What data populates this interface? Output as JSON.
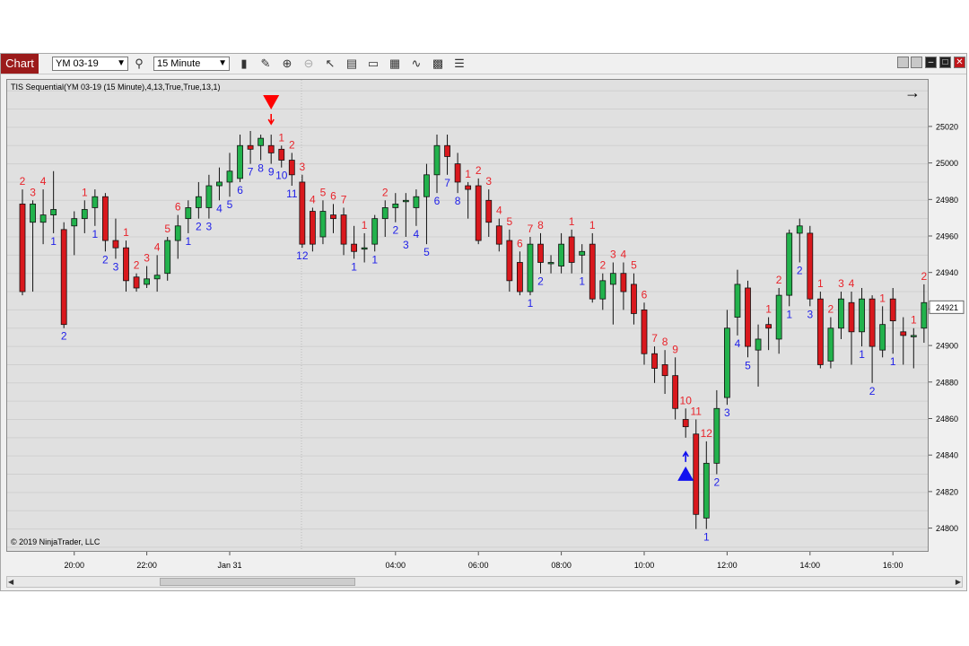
{
  "toolbar": {
    "tab_label": "Chart",
    "instrument": "YM 03-19",
    "interval": "15 Minute"
  },
  "chart": {
    "indicator_label": "TIS Sequential(YM 03-19 (15 Minute),4,13,True,True,13,1)",
    "copyright": "© 2019 NinjaTrader, LLC",
    "current_price": "24921",
    "colors": {
      "up": "#22b24c",
      "down": "#d9181d",
      "sell_count": "#e8232a",
      "buy_count": "#2020e8"
    }
  },
  "chart_data": {
    "type": "candlestick",
    "y_ticks": [
      24800,
      24820,
      24840,
      24860,
      24880,
      24900,
      24920,
      24940,
      24960,
      24980,
      25000,
      25020
    ],
    "ylim": [
      24788,
      25046
    ],
    "x_labels": [
      "20:00",
      "22:00",
      "Jan 31",
      "04:00",
      "06:00",
      "08:00",
      "10:00",
      "12:00",
      "14:00",
      "16:00"
    ],
    "grid": true,
    "bars": [
      [
        24978,
        24930,
        24986,
        24928
      ],
      [
        24968,
        24978,
        24980,
        24930
      ],
      [
        24968,
        24972,
        24986,
        24956
      ],
      [
        24972,
        24975,
        24996,
        24962
      ],
      [
        24964,
        24912,
        24968,
        24910
      ],
      [
        24966,
        24970,
        24974,
        24950
      ],
      [
        24970,
        24975,
        24980,
        24962
      ],
      [
        24976,
        24982,
        24986,
        24966
      ],
      [
        24982,
        24958,
        24984,
        24952
      ],
      [
        24958,
        24954,
        24970,
        24948
      ],
      [
        24954,
        24936,
        24958,
        24930
      ],
      [
        24938,
        24932,
        24940,
        24930
      ],
      [
        24934,
        24937,
        24944,
        24932
      ],
      [
        24937,
        24939,
        24950,
        24930
      ],
      [
        24940,
        24958,
        24960,
        24936
      ],
      [
        24958,
        24966,
        24972,
        24948
      ],
      [
        24970,
        24976,
        24980,
        24962
      ],
      [
        24976,
        24982,
        24990,
        24970
      ],
      [
        24976,
        24988,
        24994,
        24970
      ],
      [
        24988,
        24990,
        24998,
        24980
      ],
      [
        24990,
        24996,
        25006,
        24982
      ],
      [
        24992,
        25010,
        25016,
        24990
      ],
      [
        25010,
        25008,
        25018,
        25000
      ],
      [
        25010,
        25014,
        25016,
        25002
      ],
      [
        25010,
        25006,
        25016,
        25000
      ],
      [
        25008,
        25002,
        25010,
        24998
      ],
      [
        25002,
        24994,
        25006,
        24988
      ],
      [
        24990,
        24956,
        24994,
        24954
      ],
      [
        24974,
        24956,
        24976,
        24952
      ],
      [
        24960,
        24974,
        24980,
        24956
      ],
      [
        24972,
        24970,
        24978,
        24962
      ],
      [
        24972,
        24956,
        24976,
        24950
      ],
      [
        24956,
        24952,
        24966,
        24948
      ],
      [
        24954,
        24954,
        24962,
        24946
      ],
      [
        24956,
        24970,
        24972,
        24952
      ],
      [
        24970,
        24976,
        24980,
        24960
      ],
      [
        24976,
        24978,
        24984,
        24968
      ],
      [
        24980,
        24980,
        24984,
        24960
      ],
      [
        24976,
        24982,
        24986,
        24966
      ],
      [
        24982,
        24994,
        25000,
        24956
      ],
      [
        24994,
        25010,
        25016,
        24984
      ],
      [
        25010,
        25004,
        25016,
        24994
      ],
      [
        25000,
        24990,
        25006,
        24984
      ],
      [
        24988,
        24986,
        24990,
        24970
      ],
      [
        24988,
        24958,
        24992,
        24956
      ],
      [
        24980,
        24968,
        24986,
        24960
      ],
      [
        24966,
        24956,
        24970,
        24952
      ],
      [
        24958,
        24936,
        24964,
        24930
      ],
      [
        24946,
        24930,
        24952,
        24928
      ],
      [
        24930,
        24956,
        24960,
        24928
      ],
      [
        24956,
        24946,
        24962,
        24940
      ],
      [
        24946,
        24946,
        24950,
        24940
      ],
      [
        24944,
        24956,
        24962,
        24940
      ],
      [
        24960,
        24946,
        24964,
        24940
      ],
      [
        24950,
        24952,
        24956,
        24940
      ],
      [
        24956,
        24926,
        24962,
        24924
      ],
      [
        24926,
        24936,
        24940,
        24920
      ],
      [
        24934,
        24940,
        24946,
        24912
      ],
      [
        24940,
        24930,
        24946,
        24920
      ],
      [
        24934,
        24918,
        24940,
        24912
      ],
      [
        24920,
        24896,
        24924,
        24890
      ],
      [
        24896,
        24888,
        24900,
        24880
      ],
      [
        24890,
        24884,
        24898,
        24874
      ],
      [
        24884,
        24866,
        24894,
        24860
      ],
      [
        24860,
        24856,
        24866,
        24850
      ],
      [
        24852,
        24808,
        24860,
        24800
      ],
      [
        24806,
        24836,
        24848,
        24800
      ],
      [
        24836,
        24866,
        24876,
        24830
      ],
      [
        24872,
        24910,
        24920,
        24868
      ],
      [
        24916,
        24934,
        24942,
        24906
      ],
      [
        24932,
        24900,
        24936,
        24894
      ],
      [
        24898,
        24904,
        24912,
        24878
      ],
      [
        24912,
        24910,
        24916,
        24898
      ],
      [
        24904,
        24928,
        24932,
        24896
      ],
      [
        24928,
        24962,
        24964,
        24922
      ],
      [
        24962,
        24966,
        24970,
        24946
      ],
      [
        24962,
        24926,
        24966,
        24922
      ],
      [
        24926,
        24890,
        24930,
        24888
      ],
      [
        24892,
        24910,
        24916,
        24888
      ],
      [
        24910,
        24926,
        24930,
        24904
      ],
      [
        24924,
        24908,
        24930,
        24890
      ],
      [
        24908,
        24926,
        24932,
        24900
      ],
      [
        24926,
        24900,
        24928,
        24880
      ],
      [
        24898,
        24912,
        24922,
        24894
      ],
      [
        24926,
        24914,
        24932,
        24896
      ],
      [
        24908,
        24906,
        24916,
        24890
      ],
      [
        24906,
        24906,
        24910,
        24888
      ],
      [
        24910,
        24924,
        24934,
        24902
      ]
    ],
    "counts": [
      {
        "i": 0,
        "t": "2",
        "pos": "above"
      },
      {
        "i": 1,
        "t": "3",
        "pos": "above"
      },
      {
        "i": 2,
        "t": "4",
        "pos": "above"
      },
      {
        "i": 3,
        "t": "1",
        "pos": "below"
      },
      {
        "i": 4,
        "t": "2",
        "pos": "below"
      },
      {
        "i": 6,
        "t": "1",
        "pos": "above"
      },
      {
        "i": 7,
        "t": "1",
        "pos": "below"
      },
      {
        "i": 8,
        "t": "2",
        "pos": "below"
      },
      {
        "i": 9,
        "t": "3",
        "pos": "below"
      },
      {
        "i": 10,
        "t": "1",
        "pos": "above"
      },
      {
        "i": 11,
        "t": "2",
        "pos": "above"
      },
      {
        "i": 12,
        "t": "3",
        "pos": "above"
      },
      {
        "i": 13,
        "t": "4",
        "pos": "above"
      },
      {
        "i": 14,
        "t": "5",
        "pos": "above"
      },
      {
        "i": 15,
        "t": "6",
        "pos": "above"
      },
      {
        "i": 16,
        "t": "1",
        "pos": "below"
      },
      {
        "i": 17,
        "t": "2",
        "pos": "below"
      },
      {
        "i": 18,
        "t": "3",
        "pos": "below"
      },
      {
        "i": 19,
        "t": "4",
        "pos": "below"
      },
      {
        "i": 20,
        "t": "5",
        "pos": "below"
      },
      {
        "i": 21,
        "t": "6",
        "pos": "below"
      },
      {
        "i": 22,
        "t": "7",
        "pos": "below"
      },
      {
        "i": 23,
        "t": "8",
        "pos": "below"
      },
      {
        "i": 24,
        "t": "9",
        "pos": "below"
      },
      {
        "i": 25,
        "t": "10",
        "pos": "below"
      },
      {
        "i": 26,
        "t": "11",
        "pos": "below"
      },
      {
        "i": 27,
        "t": "12",
        "pos": "below"
      },
      {
        "i": 25,
        "t": "1",
        "pos": "above"
      },
      {
        "i": 26,
        "t": "2",
        "pos": "above"
      },
      {
        "i": 27,
        "t": "3",
        "pos": "above"
      },
      {
        "i": 28,
        "t": "4",
        "pos": "above"
      },
      {
        "i": 29,
        "t": "5",
        "pos": "above"
      },
      {
        "i": 30,
        "t": "6",
        "pos": "above"
      },
      {
        "i": 31,
        "t": "7",
        "pos": "above"
      },
      {
        "i": 32,
        "t": "1",
        "pos": "below"
      },
      {
        "i": 33,
        "t": "1",
        "pos": "above"
      },
      {
        "i": 34,
        "t": "1",
        "pos": "below"
      },
      {
        "i": 35,
        "t": "2",
        "pos": "above"
      },
      {
        "i": 36,
        "t": "2",
        "pos": "below"
      },
      {
        "i": 37,
        "t": "3",
        "pos": "below"
      },
      {
        "i": 38,
        "t": "4",
        "pos": "below"
      },
      {
        "i": 39,
        "t": "5",
        "pos": "below"
      },
      {
        "i": 40,
        "t": "6",
        "pos": "below"
      },
      {
        "i": 41,
        "t": "7",
        "pos": "below"
      },
      {
        "i": 42,
        "t": "8",
        "pos": "below"
      },
      {
        "i": 43,
        "t": "1",
        "pos": "above"
      },
      {
        "i": 44,
        "t": "2",
        "pos": "above"
      },
      {
        "i": 45,
        "t": "3",
        "pos": "above"
      },
      {
        "i": 46,
        "t": "4",
        "pos": "above"
      },
      {
        "i": 47,
        "t": "5",
        "pos": "above"
      },
      {
        "i": 48,
        "t": "6",
        "pos": "above"
      },
      {
        "i": 49,
        "t": "7",
        "pos": "above"
      },
      {
        "i": 50,
        "t": "8",
        "pos": "above"
      },
      {
        "i": 49,
        "t": "1",
        "pos": "below"
      },
      {
        "i": 50,
        "t": "2",
        "pos": "below"
      },
      {
        "i": 53,
        "t": "1",
        "pos": "above"
      },
      {
        "i": 54,
        "t": "1",
        "pos": "below"
      },
      {
        "i": 55,
        "t": "1",
        "pos": "above"
      },
      {
        "i": 56,
        "t": "2",
        "pos": "above"
      },
      {
        "i": 57,
        "t": "3",
        "pos": "above"
      },
      {
        "i": 58,
        "t": "4",
        "pos": "above"
      },
      {
        "i": 59,
        "t": "5",
        "pos": "above"
      },
      {
        "i": 60,
        "t": "6",
        "pos": "above"
      },
      {
        "i": 61,
        "t": "7",
        "pos": "above"
      },
      {
        "i": 62,
        "t": "8",
        "pos": "above"
      },
      {
        "i": 63,
        "t": "9",
        "pos": "above"
      },
      {
        "i": 64,
        "t": "10",
        "pos": "above"
      },
      {
        "i": 65,
        "t": "11",
        "pos": "above"
      },
      {
        "i": 66,
        "t": "12",
        "pos": "above"
      },
      {
        "i": 66,
        "t": "1",
        "pos": "below"
      },
      {
        "i": 67,
        "t": "2",
        "pos": "below"
      },
      {
        "i": 68,
        "t": "3",
        "pos": "below"
      },
      {
        "i": 69,
        "t": "4",
        "pos": "below"
      },
      {
        "i": 70,
        "t": "5",
        "pos": "below"
      },
      {
        "i": 72,
        "t": "1",
        "pos": "above"
      },
      {
        "i": 73,
        "t": "2",
        "pos": "above"
      },
      {
        "i": 74,
        "t": "1",
        "pos": "below"
      },
      {
        "i": 75,
        "t": "2",
        "pos": "below"
      },
      {
        "i": 76,
        "t": "3",
        "pos": "below"
      },
      {
        "i": 77,
        "t": "1",
        "pos": "above"
      },
      {
        "i": 78,
        "t": "2",
        "pos": "above"
      },
      {
        "i": 79,
        "t": "3",
        "pos": "above"
      },
      {
        "i": 80,
        "t": "4",
        "pos": "above"
      },
      {
        "i": 81,
        "t": "1",
        "pos": "below"
      },
      {
        "i": 82,
        "t": "2",
        "pos": "below"
      },
      {
        "i": 83,
        "t": "1",
        "pos": "above"
      },
      {
        "i": 84,
        "t": "1",
        "pos": "below"
      },
      {
        "i": 86,
        "t": "1",
        "pos": "above"
      },
      {
        "i": 87,
        "t": "2",
        "pos": "above"
      }
    ],
    "signals": [
      {
        "i": 24,
        "type": "sell"
      },
      {
        "i": 64,
        "type": "buy"
      }
    ]
  }
}
